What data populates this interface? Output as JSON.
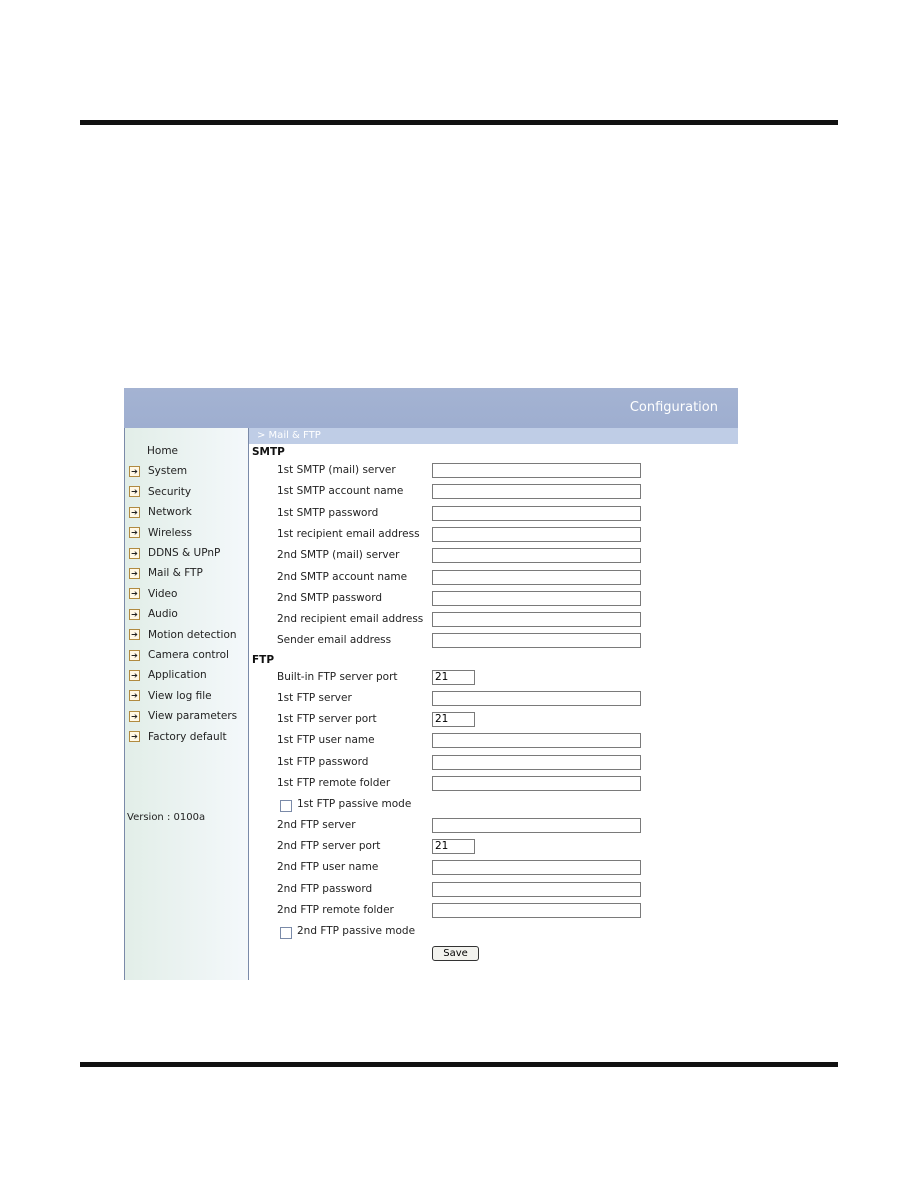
{
  "header": {
    "title": "Configuration"
  },
  "breadcrumb": "> Mail & FTP",
  "sidebar": {
    "items": [
      {
        "label": "Home",
        "icon": ""
      },
      {
        "label": "System",
        "icon": "arrow-right-icon"
      },
      {
        "label": "Security",
        "icon": "arrow-right-icon"
      },
      {
        "label": "Network",
        "icon": "arrow-right-icon"
      },
      {
        "label": "Wireless",
        "icon": "arrow-right-icon"
      },
      {
        "label": "DDNS & UPnP",
        "icon": "arrow-right-icon"
      },
      {
        "label": "Mail & FTP",
        "icon": "arrow-right-icon"
      },
      {
        "label": "Video",
        "icon": "arrow-right-icon"
      },
      {
        "label": "Audio",
        "icon": "arrow-right-icon"
      },
      {
        "label": "Motion detection",
        "icon": "arrow-right-icon"
      },
      {
        "label": "Camera control",
        "icon": "arrow-right-icon"
      },
      {
        "label": "Application",
        "icon": "arrow-right-icon"
      },
      {
        "label": "View log file",
        "icon": "arrow-right-icon"
      },
      {
        "label": "View parameters",
        "icon": "arrow-right-icon"
      },
      {
        "label": "Factory default",
        "icon": "arrow-right-icon"
      }
    ],
    "version": "Version : 0100a"
  },
  "smtp": {
    "heading": "SMTP",
    "fields": [
      {
        "label": "1st SMTP (mail) server",
        "value": ""
      },
      {
        "label": "1st SMTP account name",
        "value": ""
      },
      {
        "label": "1st SMTP password",
        "value": ""
      },
      {
        "label": "1st recipient email address",
        "value": ""
      },
      {
        "label": "2nd SMTP (mail) server",
        "value": ""
      },
      {
        "label": "2nd SMTP account name",
        "value": ""
      },
      {
        "label": "2nd SMTP password",
        "value": ""
      },
      {
        "label": "2nd recipient email address",
        "value": ""
      },
      {
        "label": "Sender email address",
        "value": ""
      }
    ]
  },
  "ftp": {
    "heading": "FTP",
    "fields": [
      {
        "type": "text",
        "label": "Built-in FTP server port",
        "value": "21",
        "small": true
      },
      {
        "type": "text",
        "label": "1st FTP server",
        "value": ""
      },
      {
        "type": "text",
        "label": "1st FTP server port",
        "value": "21",
        "small": true
      },
      {
        "type": "text",
        "label": "1st FTP user name",
        "value": ""
      },
      {
        "type": "text",
        "label": "1st FTP password",
        "value": ""
      },
      {
        "type": "text",
        "label": "1st FTP remote folder",
        "value": ""
      },
      {
        "type": "checkbox",
        "label": "1st FTP passive mode",
        "checked": false
      },
      {
        "type": "text",
        "label": "2nd FTP server",
        "value": ""
      },
      {
        "type": "text",
        "label": "2nd FTP server port",
        "value": "21",
        "small": true
      },
      {
        "type": "text",
        "label": "2nd FTP user name",
        "value": ""
      },
      {
        "type": "text",
        "label": "2nd FTP password",
        "value": ""
      },
      {
        "type": "text",
        "label": "2nd FTP remote folder",
        "value": ""
      },
      {
        "type": "checkbox",
        "label": "2nd FTP passive mode",
        "checked": false
      }
    ]
  },
  "save_label": "Save"
}
